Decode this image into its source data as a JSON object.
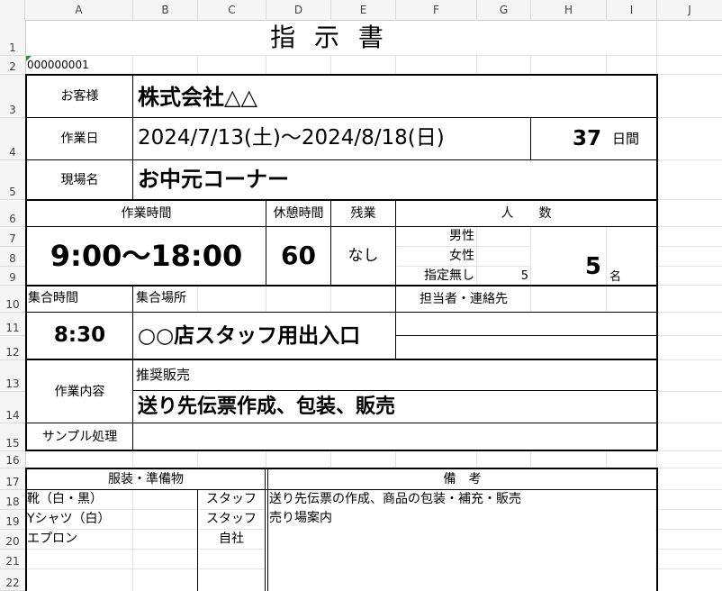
{
  "columns": [
    "A",
    "B",
    "C",
    "D",
    "E",
    "F",
    "G",
    "H",
    "I",
    "J"
  ],
  "rows": [
    "1",
    "2",
    "3",
    "4",
    "5",
    "6",
    "7",
    "8",
    "9",
    "10",
    "11",
    "12",
    "13",
    "14",
    "15",
    "16",
    "17",
    "18",
    "19",
    "20",
    "21",
    "22"
  ],
  "form": {
    "title": "指 示 書",
    "doc_number": "000000001",
    "customer_label": "お客様",
    "customer_value": "株式会社△△",
    "work_date_label": "作業日",
    "work_date_value": "2024/7/13(土)～2024/8/18(日)",
    "days_value": "37",
    "days_unit": "日間",
    "site_label": "現場名",
    "site_value": "お中元コーナー",
    "work_hours_label": "作業時間",
    "work_hours_value": "9:00～18:00",
    "break_label": "休憩時間",
    "break_value": "60",
    "overtime_label": "残業",
    "overtime_value": "なし",
    "headcount_label": "人　　数",
    "male_label": "男性",
    "female_label": "女性",
    "unspecified_label": "指定無し",
    "unspecified_value": "5",
    "total_value": "5",
    "total_unit": "名",
    "meet_time_label": "集合時間",
    "meet_time_value": "8:30",
    "meet_place_label": "集合場所",
    "meet_place_value": "○○店スタッフ用出入口",
    "contact_label": "担当者・連絡先",
    "content_label": "作業内容",
    "content_sub": "推奨販売",
    "content_value": "送り先伝票作成、包装、販売",
    "sample_label": "サンプル処理",
    "items_header": "服装・準備物",
    "remarks_header": "備　考",
    "items": [
      {
        "name": "靴（白・黒）",
        "provider": "スタッフ"
      },
      {
        "name": "Yシャツ（白）",
        "provider": "スタッフ"
      },
      {
        "name": "エプロン",
        "provider": "自社"
      }
    ],
    "remarks": [
      "送り先伝票の作成、商品の包装・補充・販売",
      "売り場案内"
    ]
  }
}
